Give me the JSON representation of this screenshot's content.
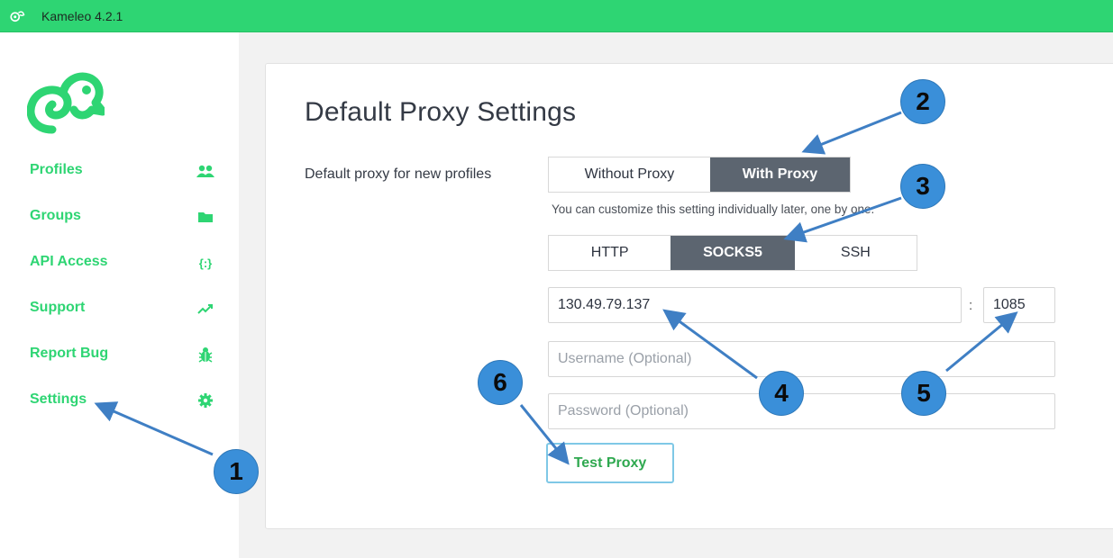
{
  "app": {
    "title": "Kameleo 4.2.1"
  },
  "sidebar": {
    "items": [
      {
        "label": "Profiles",
        "icon": "users-icon"
      },
      {
        "label": "Groups",
        "icon": "folder-icon"
      },
      {
        "label": "API Access",
        "icon": "code-braces-icon",
        "glyph": "{:}"
      },
      {
        "label": "Support",
        "icon": "trending-up-icon"
      },
      {
        "label": "Report Bug",
        "icon": "bug-icon"
      },
      {
        "label": "Settings",
        "icon": "gear-icon"
      }
    ]
  },
  "main": {
    "title": "Default Proxy Settings",
    "proxy_label": "Default proxy for new profiles",
    "proxy_options": [
      "Without Proxy",
      "With Proxy"
    ],
    "proxy_selected": "With Proxy",
    "hint": "You can customize this setting individually later, one by one.",
    "types": [
      "HTTP",
      "SOCKS5",
      "SSH"
    ],
    "type_selected": "SOCKS5",
    "host": "130.49.79.137",
    "colon": ":",
    "port": "1085",
    "username_placeholder": "Username (Optional)",
    "password_placeholder": "Password (Optional)",
    "test_button": "Test Proxy"
  },
  "annotations": [
    "1",
    "2",
    "3",
    "4",
    "5",
    "6"
  ],
  "colors": {
    "brand_green": "#2ed573",
    "badge_blue": "#3a8fd9",
    "segment_active": "#5c6570"
  }
}
